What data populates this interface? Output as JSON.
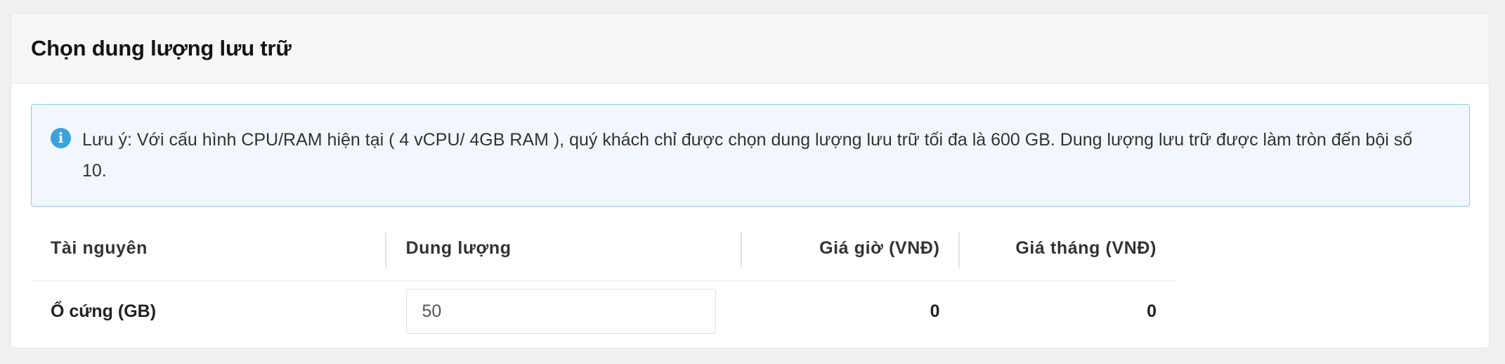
{
  "section": {
    "title": "Chọn dung lượng lưu trữ"
  },
  "notice": {
    "icon": "info-icon",
    "icon_glyph": "i",
    "icon_color": "#3aa3dc",
    "text": "Lưu ý: Với cấu hình CPU/RAM hiện tại ( 4 vCPU/ 4GB RAM ), quý khách chỉ được chọn dung lượng lưu trữ tối đa là 600 GB. Dung lượng lưu trữ được làm tròn đến bội số 10."
  },
  "table": {
    "headers": {
      "resource": "Tài nguyên",
      "capacity": "Dung lượng",
      "hourly_price": "Giá giờ (VNĐ)",
      "monthly_price": "Giá tháng (VNĐ)"
    },
    "rows": [
      {
        "resource": "Ổ cứng (GB)",
        "capacity": "50",
        "hourly_price": "0",
        "monthly_price": "0"
      }
    ]
  }
}
